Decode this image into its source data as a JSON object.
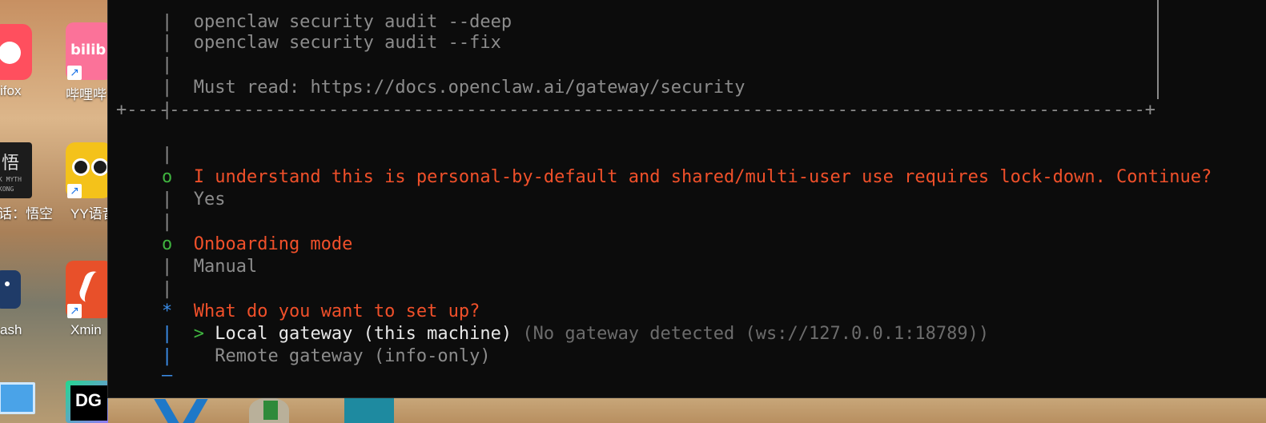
{
  "desktop": {
    "icons": [
      {
        "label": "ifox",
        "icon": "firefox-icon",
        "color": "#ff4f5e"
      },
      {
        "label": "哔哩哔",
        "icon": "bilibili-icon",
        "color": "#fb7299"
      },
      {
        "label": "话：悟空",
        "icon": "wukong-game-icon",
        "color": "#1c1c1c"
      },
      {
        "label": "YY语音",
        "icon": "yy-voice-icon",
        "color": "#f4c21a"
      },
      {
        "label": "ash",
        "icon": "clash-icon",
        "color": "#1f3b68"
      },
      {
        "label": "Xmin",
        "icon": "xmind-icon",
        "color": "#e8502a"
      },
      {
        "label": "DG",
        "icon": "datagrip-icon",
        "color": "#1b8a5a"
      }
    ]
  },
  "terminal": {
    "lines": {
      "l1": "openclaw security audit --deep",
      "l2": "openclaw security audit --fix",
      "l3_prefix": "Must read: ",
      "l3_link": "https://docs.openclaw.ai/gateway/security",
      "divider": "+------------------------------------------------------------------------------------------------+"
    },
    "bar_char": "|",
    "done_marker": "o",
    "active_marker": "*",
    "end_marker": "—",
    "q1": {
      "question": "I understand this is personal-by-default and shared/multi-user use requires lock-down. Continue?",
      "answer": "Yes"
    },
    "q2": {
      "question": "Onboarding mode",
      "answer": "Manual"
    },
    "q3": {
      "question": "What do you want to set up?",
      "cursor": ">",
      "option1_label": "Local gateway (this machine)",
      "option1_hint": "(No gateway detected (ws://127.0.0.1:18789))",
      "option2_label": "Remote gateway (info-only)"
    }
  },
  "colors": {
    "terminal_bg": "#0c0c0c",
    "prompt_orange": "#f0502a",
    "done_green": "#3fb43f",
    "active_blue": "#3b8eea",
    "muted_gray": "#8c8c8c"
  }
}
